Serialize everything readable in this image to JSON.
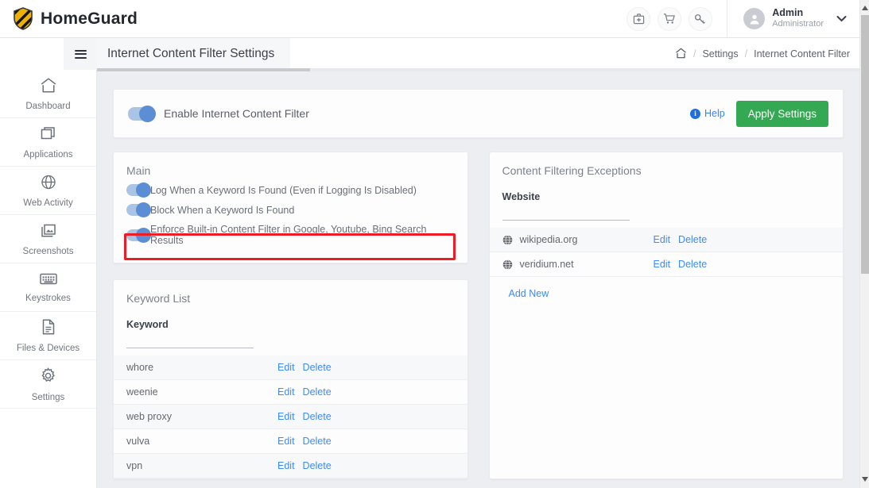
{
  "header": {
    "brand": "HomeGuard",
    "icons": [
      {
        "name": "first-aid-icon",
        "glyph": "⛑"
      },
      {
        "name": "cart-icon",
        "glyph": "🛒"
      },
      {
        "name": "key-icon",
        "glyph": "🔑"
      }
    ],
    "user_name": "Admin",
    "user_role": "Administrator",
    "chevron": "⌄"
  },
  "subbar": {
    "page_title": "Internet Content Filter Settings",
    "breadcrumb": {
      "home_icon": "home-icon",
      "separator": "/",
      "items": [
        "Settings",
        "Internet Content Filter"
      ]
    }
  },
  "sidebar": {
    "items": [
      {
        "label": "Dashboard",
        "icon": "home-icon"
      },
      {
        "label": "Applications",
        "icon": "windows-icon"
      },
      {
        "label": "Web Activity",
        "icon": "globe-icon"
      },
      {
        "label": "Screenshots",
        "icon": "image-icon"
      },
      {
        "label": "Keystrokes",
        "icon": "keyboard-icon"
      },
      {
        "label": "Files & Devices",
        "icon": "document-icon"
      },
      {
        "label": "Settings",
        "icon": "gear-icon"
      }
    ]
  },
  "enable_card": {
    "toggle_label": "Enable Internet Content Filter",
    "toggle_on": true,
    "help_label": "Help",
    "apply_label": "Apply Settings",
    "apply_color": "#34a853"
  },
  "main_panel": {
    "title": "Main",
    "options": [
      {
        "label": "Log When a Keyword Is Found (Even if Logging Is Disabled)",
        "on": true,
        "highlighted": false
      },
      {
        "label": "Block When a Keyword Is Found",
        "on": true,
        "highlighted": false
      },
      {
        "label": "Enforce Built-in Content Filter in Google, Youtube, Bing Search Results",
        "on": true,
        "highlighted": true
      }
    ],
    "highlight_color": "#ee1c25"
  },
  "keyword_panel": {
    "title": "Keyword List",
    "column_header": "Keyword",
    "edit_label": "Edit",
    "delete_label": "Delete",
    "rows": [
      {
        "keyword": "whore"
      },
      {
        "keyword": "weenie"
      },
      {
        "keyword": "web proxy"
      },
      {
        "keyword": "vulva"
      },
      {
        "keyword": "vpn"
      }
    ]
  },
  "exceptions_panel": {
    "title": "Content Filtering Exceptions",
    "column_header": "Website",
    "edit_label": "Edit",
    "delete_label": "Delete",
    "add_new_label": "Add New",
    "rows": [
      {
        "website": "wikipedia.org",
        "icon": "globe-favicon"
      },
      {
        "website": "veridium.net",
        "icon": "globe-favicon"
      }
    ]
  }
}
